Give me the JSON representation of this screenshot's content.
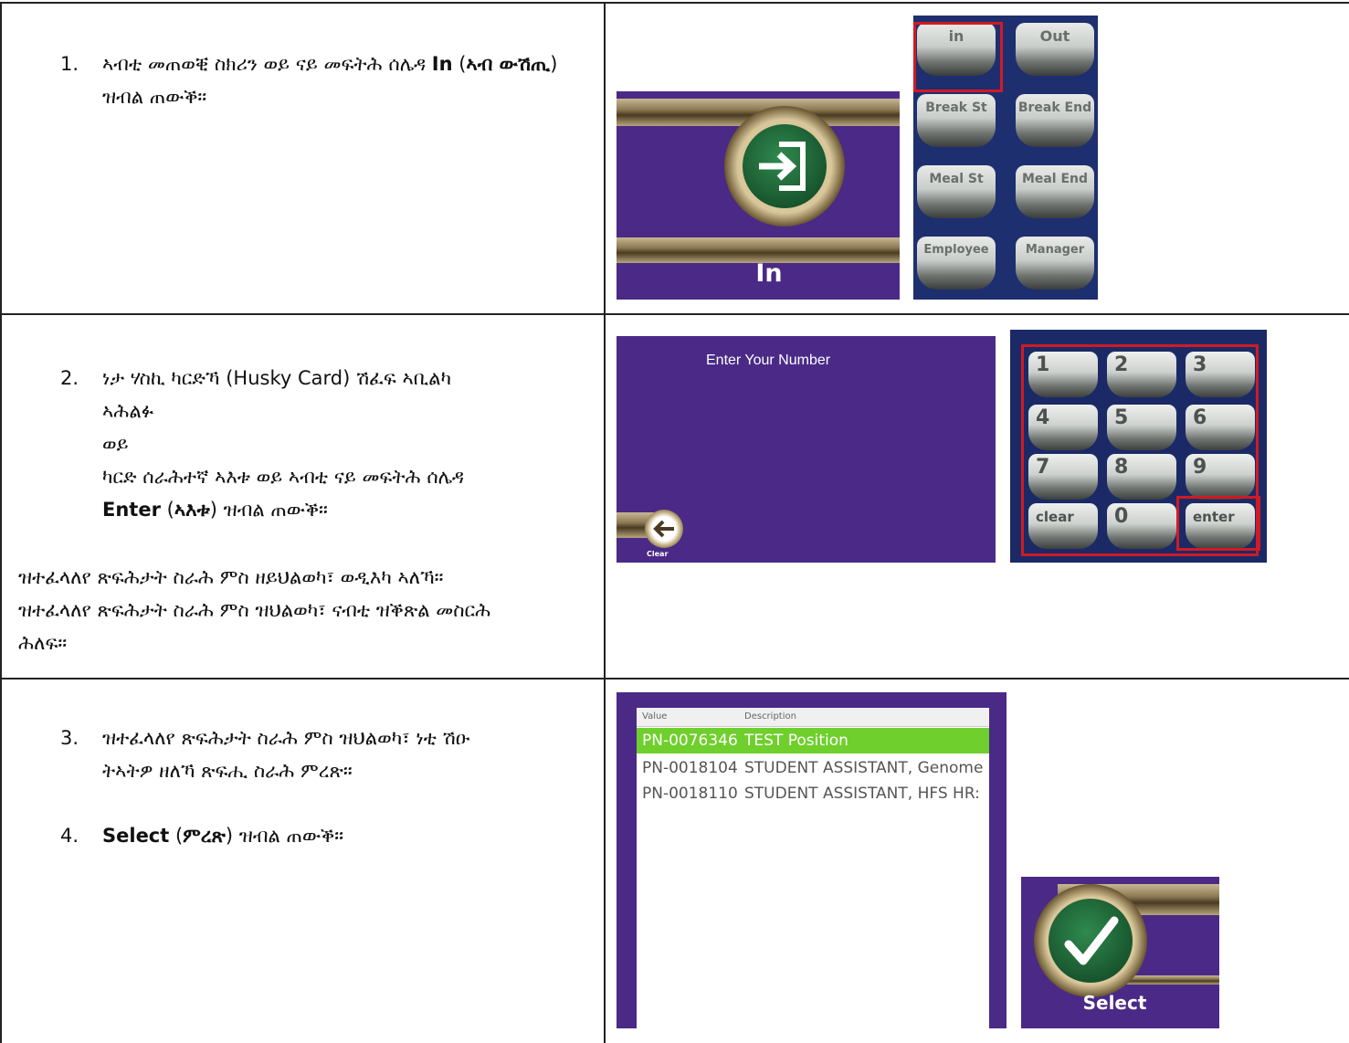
{
  "rows": [
    {
      "number": "1.",
      "parts": [
        "ኣብቲ መጠወቒ ስክሪን ወይ ናይ መፍትሕ ሰሌዳ ",
        "In",
        " (",
        "ኣብ ውሽጢ",
        ") ዝብል ጠውቕ።"
      ]
    },
    {
      "number": "2.",
      "line1": "ነታ ሃስኪ ካርድኻ (Husky Card) ሽፈፍ ኣቢልካ",
      "line2": "ኣሕልፉ",
      "line3": "ወይ",
      "line4": "ካርድ ሰራሕተኛ ኣእቱ ወይ ኣብቲ ናይ መፍትሕ ሰሌዳ",
      "line5_bold": "Enter",
      "line5_mid_a": " (",
      "line5_bold2": "ኣእቱ",
      "line5_end": ") ዝብል ጠውቕ።",
      "note1": "ዝተፈላለየ ጽፍሕታት ስራሕ ምስ ዘይህልወካ፣ ወዲእካ ኣለኻ።",
      "note2": "ዝተፈላለየ ጽፍሕታት ስራሕ ምስ ዝህልወካ፣ ናብቲ ዝቕጽል መስርሕ",
      "note3": "ሕለፍ።"
    },
    {
      "number3": "3.",
      "line1": "ዝተፈላለየ ጽፍሕታት ስራሕ ምስ ዝህልወካ፣ ነቲ ሽዑ",
      "line2": "ትኣትዎ ዘለኻ ጽፍሒ ስራሕ ምረጽ።",
      "number4": "4.",
      "select_bold": "Select",
      "select_mid": " (",
      "select_bold2": "ምረጽ",
      "select_end": ") ዝብል ጠውቕ።"
    }
  ],
  "screens": {
    "in_label": "In",
    "enter_number": "Enter Your Number",
    "clear_label": "Clear",
    "select_label": "Select"
  },
  "keypad1": [
    "in",
    "Out",
    "Break St",
    "Break End",
    "Meal St",
    "Meal End",
    "Employee",
    "Manager"
  ],
  "keypad2": [
    "1",
    "2",
    "3",
    "4",
    "5",
    "6",
    "7",
    "8",
    "9",
    "clear",
    "0",
    "enter"
  ],
  "list": {
    "header_value": "Value",
    "header_desc": "Description",
    "items": [
      {
        "value": "PN-0076346",
        "desc": "TEST Position"
      },
      {
        "value": "PN-0018104",
        "desc": "STUDENT ASSISTANT, Genome"
      },
      {
        "value": "PN-0018110",
        "desc": "STUDENT ASSISTANT, HFS HR:"
      }
    ]
  },
  "colors": {
    "purple": "#4a2a86",
    "green_highlight": "#6fcf2c",
    "red_box": "#d01a24"
  }
}
